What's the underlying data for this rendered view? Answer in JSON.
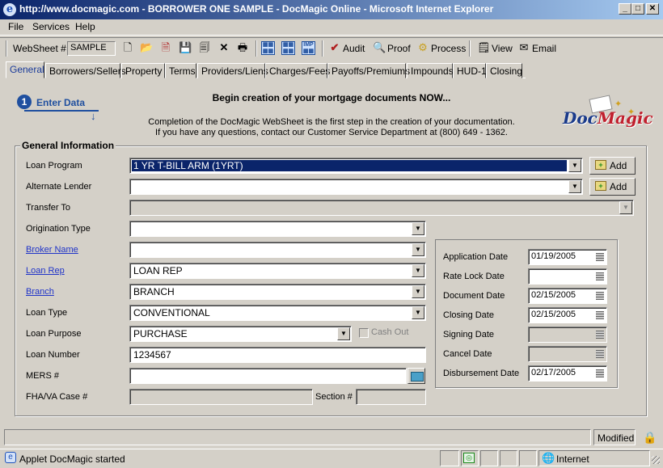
{
  "window": {
    "title": "http://www.docmagic.com - BORROWER ONE SAMPLE - DocMagic Online - Microsoft Internet Explorer",
    "minimize": "_",
    "maximize": "□",
    "close": "✕"
  },
  "menu": {
    "file": "File",
    "services": "Services",
    "help": "Help"
  },
  "toolbar": {
    "websheet_label": "WebSheet #",
    "websheet_value": "SAMPLE",
    "audit": "Audit",
    "proof": "Proof",
    "process": "Process",
    "view": "View",
    "email": "Email"
  },
  "tabs": [
    "General",
    "Borrowers/Sellers",
    "Property",
    "Terms",
    "Providers/Liens",
    "Charges/Fees",
    "Payoffs/Premiums",
    "Impounds",
    "HUD-1",
    "Closing"
  ],
  "header": {
    "step_number": "1",
    "step_label": "Enter Data",
    "heading": "Begin creation of your mortgage documents NOW...",
    "intro_line1": "Completion of the DocMagic WebSheet is the first step in the creation of your documentation.",
    "intro_line2": "If you have any questions, contact our Customer Service Department at (800) 649 - 1362.",
    "logo_doc": "Doc",
    "logo_magic": "Magic"
  },
  "general": {
    "title": "General Information",
    "loan_program_label": "Loan Program",
    "loan_program_value": "1 YR T-BILL ARM (1YRT)",
    "alternate_lender_label": "Alternate Lender",
    "alternate_lender_value": "",
    "transfer_to_label": "Transfer To",
    "origination_type_label": "Origination Type",
    "origination_type_value": "",
    "broker_name_label": "Broker Name",
    "broker_name_value": "",
    "loan_rep_label": "Loan Rep",
    "loan_rep_value": "LOAN REP",
    "branch_label": "Branch",
    "branch_value": "BRANCH",
    "loan_type_label": "Loan Type",
    "loan_type_value": "CONVENTIONAL",
    "loan_purpose_label": "Loan Purpose",
    "loan_purpose_value": "PURCHASE",
    "cash_out_label": "Cash Out",
    "loan_number_label": "Loan Number",
    "loan_number_value": "1234567",
    "mers_label": "MERS #",
    "mers_value": "",
    "fha_label": "FHA/VA Case #",
    "section_label": "Section #",
    "add_label": "Add"
  },
  "dates": {
    "application_label": "Application Date",
    "application_value": "01/19/2005",
    "rate_lock_label": "Rate Lock Date",
    "rate_lock_value": "",
    "document_label": "Document Date",
    "document_value": "02/15/2005",
    "closing_label": "Closing Date",
    "closing_value": "02/15/2005",
    "signing_label": "Signing Date",
    "signing_value": "",
    "cancel_label": "Cancel Date",
    "cancel_value": "",
    "disbursement_label": "Disbursement Date",
    "disbursement_value": "02/17/2005"
  },
  "status": {
    "modified": "Modified",
    "applet": "Applet DocMagic started",
    "zone": "Internet"
  }
}
